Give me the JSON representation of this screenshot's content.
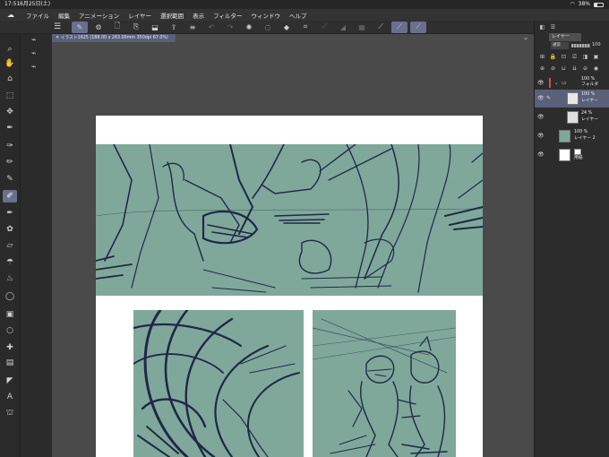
{
  "status_bar": {
    "time": "17:51",
    "date": "6月25日(土)",
    "battery": "38%"
  },
  "menu": {
    "items": [
      "ファイル",
      "編集",
      "アニメーション",
      "レイヤー",
      "選択範囲",
      "表示",
      "フィルター",
      "ウィンドウ",
      "ヘルプ"
    ]
  },
  "document": {
    "tab_title": "イラスト1625 (188.00 x 263.00mm 350dpi 67.0%)"
  },
  "layer_panel": {
    "tab_label": "レイヤー",
    "blend_mode": "通常",
    "opacity": "100",
    "layers": [
      {
        "opacity": "100 %",
        "name": "フォルダ"
      },
      {
        "opacity": "100 %",
        "name": "レイヤー"
      },
      {
        "opacity": "24 %",
        "name": "レイヤー"
      },
      {
        "opacity": "100 %",
        "name": "レイヤー 2"
      },
      {
        "opacity": "",
        "name": "用紙"
      }
    ]
  },
  "colors": {
    "main": "#232d5a",
    "sub": "#b43a3a",
    "panel_fill": "#7fa89a",
    "sketch_stroke": "#1f2847"
  }
}
